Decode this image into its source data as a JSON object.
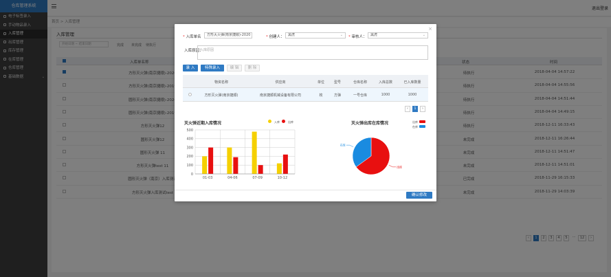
{
  "app": {
    "title": "仓库管理系统",
    "logout": "退出登录"
  },
  "sidebar": {
    "items": [
      {
        "label": "电子标签录入",
        "active": false,
        "chev": false
      },
      {
        "label": "手动物品录入",
        "active": false,
        "chev": false
      },
      {
        "label": "入库管理",
        "active": true,
        "chev": false
      },
      {
        "label": "出库管理",
        "active": false,
        "chev": false
      },
      {
        "label": "库存管理",
        "active": false,
        "chev": false
      },
      {
        "label": "在库管理",
        "active": false,
        "chev": false
      },
      {
        "label": "仓库管理",
        "active": false,
        "chev": false
      },
      {
        "label": "基础数据",
        "active": false,
        "chev": true
      }
    ]
  },
  "breadcrumb": {
    "home": "首页",
    "current": "入库管理"
  },
  "page": {
    "title": "入库管理"
  },
  "filters": {
    "date_placeholder": "开始日期 ~ 结束日期",
    "s1": "完成",
    "s2": "未完成",
    "s3": "待执行"
  },
  "table": {
    "headers": {
      "name": "入库单名称",
      "status": "状态",
      "time": "时间"
    },
    "rows": [
      {
        "name": "方形灭火弹(南京捷顺)-2020",
        "status": "待执行",
        "time": "2018-04-04 14:57:22",
        "checked": true
      },
      {
        "name": "方形灭火弹(南京捷顺)-2019",
        "status": "待执行",
        "time": "2018-04-04 14:55:56",
        "checked": false
      },
      {
        "name": "圆形灭火弹(南京捷顺)-2020",
        "status": "待执行",
        "time": "2018-04-04 14:51:44",
        "checked": false
      },
      {
        "name": "圆形灭火弹(南京捷顺)-2019",
        "status": "待执行",
        "time": "2018-04-04 14:49:15",
        "checked": false
      },
      {
        "name": "方形灭火弹12",
        "status": "待执行",
        "time": "2018-12-11 16:33:43",
        "checked": false
      },
      {
        "name": "圆形灭火弹12",
        "status": "未完成",
        "time": "2018-12-11 16:26:44",
        "checked": false
      },
      {
        "name": "圆形灭火弹 11",
        "status": "未完成",
        "time": "2018-12-11 14:51:47",
        "checked": false
      },
      {
        "name": "方形灭火弹test 11",
        "status": "未完成",
        "time": "2018-12-11 14:51:01",
        "checked": false
      },
      {
        "name": "圆形灭火弹（南京）入库测试",
        "status": "已完成",
        "time": "2018-11-29 16:15:33",
        "checked": false
      },
      {
        "name": "方形灭火弹入库测试test",
        "status": "未完成",
        "time": "2018-11-29 14:03:39",
        "checked": false
      }
    ]
  },
  "pagination": {
    "prev": "‹",
    "pages": [
      "1",
      "2",
      "3",
      "4",
      "5"
    ],
    "ellipsis": "···",
    "last": "12",
    "next": "›"
  },
  "modal": {
    "close": "×",
    "order_label": "入库单名",
    "order_value": "方形灭火弹(南京捷顺)-2020",
    "creator_label": "创建人：",
    "creator_value": "黑虎",
    "auditor_label": "审核人：",
    "auditor_value": "黑虎",
    "reason_label": "入库原因：",
    "reason_placeholder": "入库原因",
    "buttons": {
      "in": "录 入",
      "special": "特殊录入",
      "edit": "编 辑",
      "delete": "删 除"
    },
    "table": {
      "headers": [
        "物资名称",
        "供应商",
        "单位",
        "型号",
        "仓库名称",
        "入库总数",
        "已入库数量"
      ],
      "row": [
        "方形灭火弹(南京捷顺)",
        "南京捷顺机械设备有限公司",
        "枚",
        "方弹",
        "一号仓库",
        "1000",
        "1000"
      ]
    },
    "pager": {
      "prev": "‹",
      "page": "1",
      "next": "›"
    },
    "ok": "确认修改"
  },
  "chart_data": [
    {
      "type": "bar",
      "title": "灭火弹近期入库情况",
      "categories": [
        "01-03",
        "04-06",
        "07-09",
        "10-12"
      ],
      "series": [
        {
          "name": "入库",
          "color": "#f5d000",
          "values": [
            200,
            300,
            480,
            120
          ]
        },
        {
          "name": "出库",
          "color": "#e81010",
          "values": [
            300,
            190,
            100,
            220
          ]
        }
      ],
      "ylim": [
        0,
        500
      ],
      "yticks": [
        "0",
        "100",
        "200",
        "300",
        "400",
        "500"
      ],
      "grid": true,
      "legend": "top-right"
    },
    {
      "type": "pie",
      "title": "灭火弹出库在库情况",
      "slices": [
        {
          "name": "出库",
          "color": "#e81010",
          "value": 65
        },
        {
          "name": "在库",
          "color": "#1a8be0",
          "value": 35
        }
      ],
      "legend": "top-right"
    }
  ]
}
